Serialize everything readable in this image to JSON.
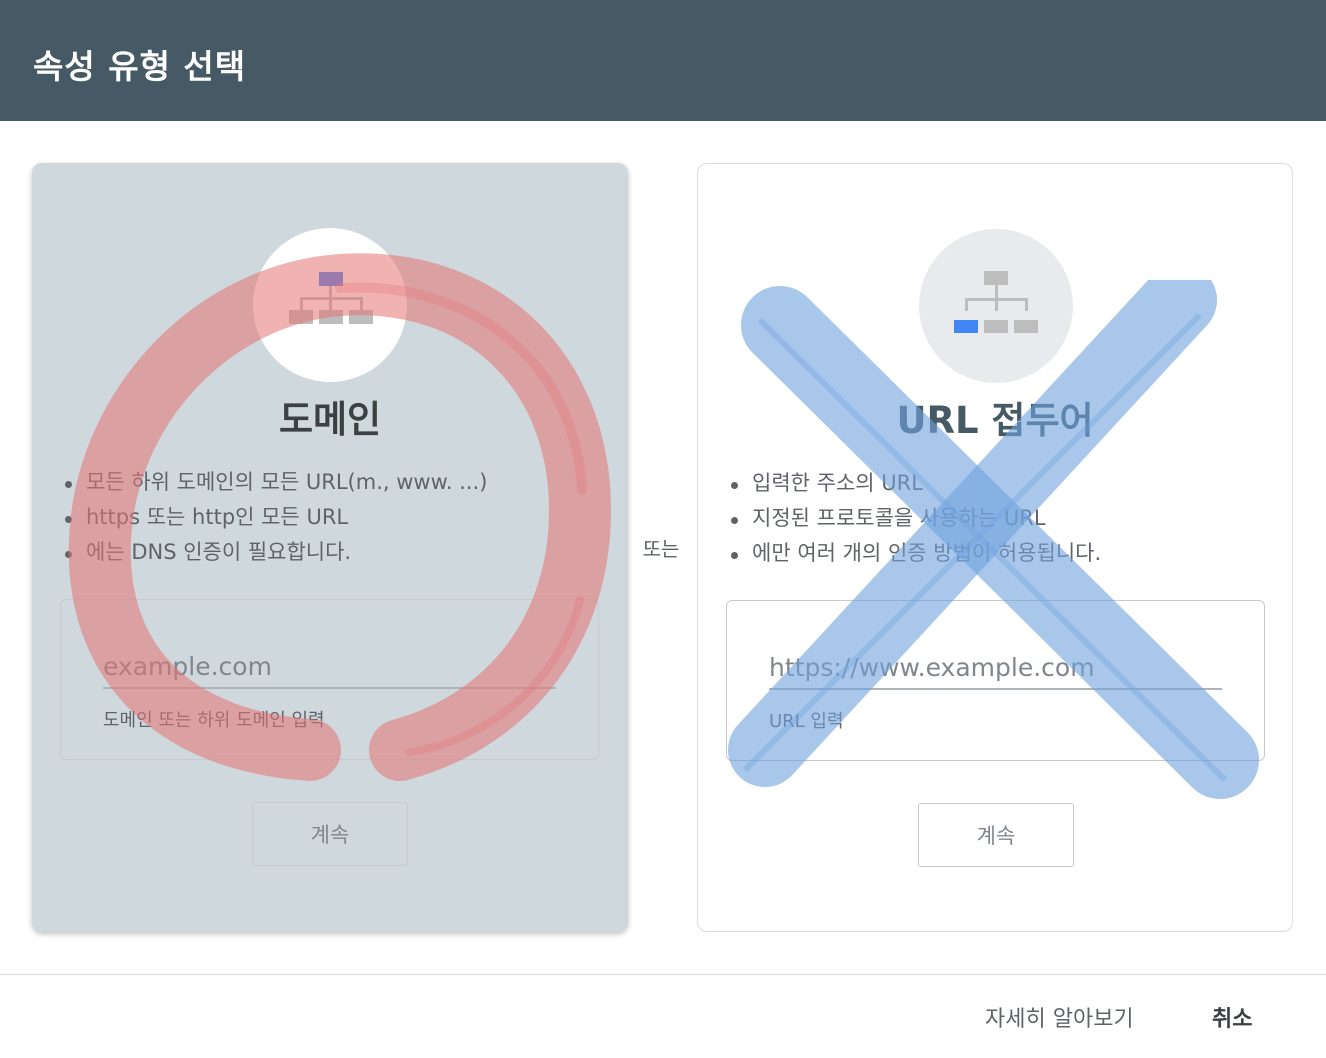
{
  "dialog": {
    "title": "속성 유형 선택"
  },
  "domain_card": {
    "title": "도메인",
    "bullets": [
      "모든 하위 도메인의 모든 URL(m., www. ...)",
      "https 또는 http인 모든 URL",
      "에는 DNS 인증이 필요합니다."
    ],
    "input_placeholder": "example.com",
    "input_value": "",
    "input_hint": "도메인 또는 하위 도메인 입력",
    "continue_label": "계속",
    "icon": "sitemap-icon",
    "background": "#cfd8dc"
  },
  "separator": {
    "or_label": "또는"
  },
  "url_card": {
    "title": "URL 접두어",
    "bullets": [
      "입력한 주소의 URL",
      "지정된 프로토콜을 사용하는 URL",
      "에만 여러 개의 인증 방법이 허용됩니다."
    ],
    "input_placeholder": "https://www.example.com",
    "input_value": "",
    "input_hint": "URL 입력",
    "continue_label": "계속",
    "icon": "sitemap-icon"
  },
  "footer": {
    "learn_more_label": "자세히 알아보기",
    "cancel_label": "취소"
  },
  "colors": {
    "header": "#455a64",
    "accent_blue": "#4285f4",
    "circle_annotation": "#e57373",
    "cross_annotation": "#6fa1dd"
  }
}
